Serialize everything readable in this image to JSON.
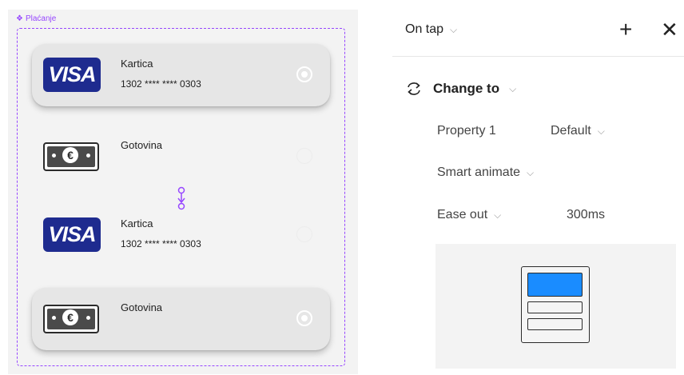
{
  "canvas": {
    "frame_label": "Plaćanje",
    "variants": [
      {
        "title": "Kartica",
        "number": "1302 **** **** 0303",
        "logo_text": "VISA",
        "type": "visa",
        "selected": true
      },
      {
        "title": "Gotovina",
        "type": "cash",
        "selected": false
      },
      {
        "title": "Kartica",
        "number": "1302 **** **** 0303",
        "logo_text": "VISA",
        "type": "visa",
        "selected": false
      },
      {
        "title": "Gotovina",
        "type": "cash",
        "selected": true
      }
    ]
  },
  "panel": {
    "trigger": "On tap",
    "action": "Change to",
    "property_label": "Property 1",
    "property_value": "Default",
    "animation": "Smart animate",
    "easing": "Ease out",
    "duration": "300ms"
  },
  "colors": {
    "frame_accent": "#9747ff",
    "visa_blue": "#1e2b8f",
    "preview_highlight": "#1a8cff"
  }
}
